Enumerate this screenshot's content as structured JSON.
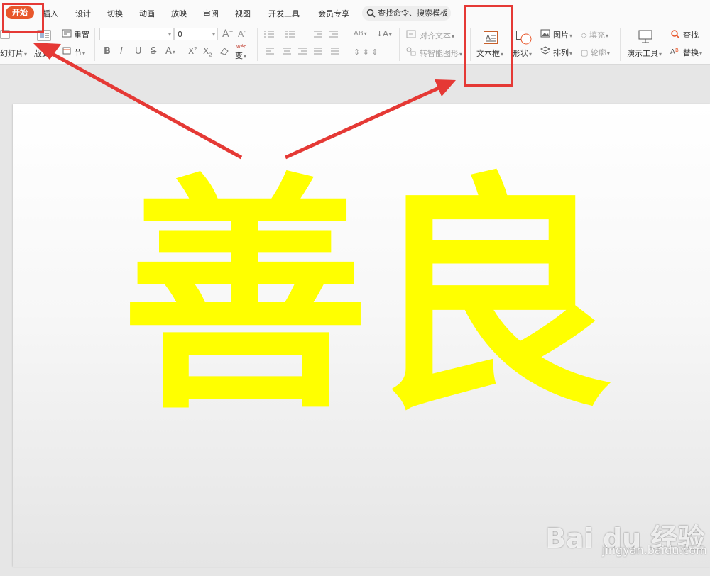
{
  "menu": {
    "tabs": [
      "开始",
      "插入",
      "设计",
      "切换",
      "动画",
      "放映",
      "审阅",
      "视图",
      "开发工具",
      "会员专享"
    ],
    "active_tab": "开始",
    "search_placeholder": "查找命令、搜索模板"
  },
  "ribbon": {
    "new_slide": "幻灯片",
    "layout": "版式",
    "reset": "重置",
    "section": "节",
    "font_size": "0",
    "wen_label": "wén",
    "wen_char": "变",
    "align_text": "对齐文本",
    "smartart": "转智能图形",
    "textbox": "文本框",
    "shape": "形状",
    "picture": "图片",
    "arrange": "排列",
    "fill": "填充",
    "outline": "轮廓",
    "presentation_tools": "演示工具",
    "find": "查找",
    "replace": "替换"
  },
  "slide": {
    "text_chars": [
      "善",
      "良"
    ],
    "text_color": "#ffff00"
  },
  "annotation": {
    "color": "#e53935"
  },
  "watermark": {
    "logo": "Bai du 经验",
    "url": "jingyan.baidu.com"
  }
}
